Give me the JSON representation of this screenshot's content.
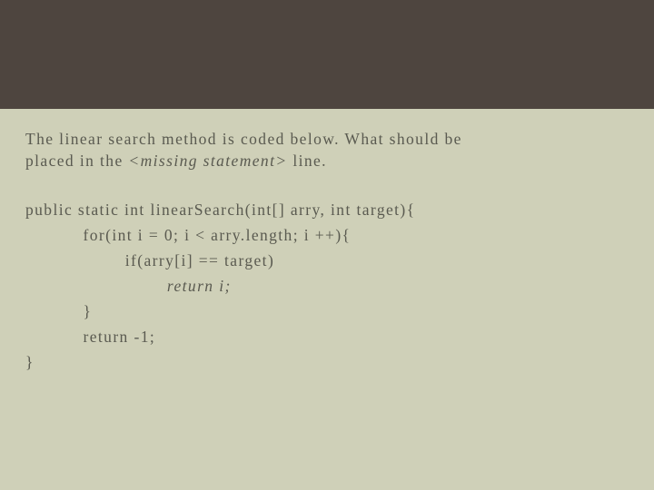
{
  "question": {
    "line1_pre": "The linear search method is coded below. What should be",
    "line2_pre": "placed in the ",
    "line2_italic": "<missing statement>",
    "line2_post": " line."
  },
  "code": {
    "l1": "public static int linearSearch(int[] arry, int target){",
    "l2": "           for(int i = 0; i < arry.length; i ++){",
    "l3": "                   if(arry[i] == target)",
    "l4_italic": "                           return i;",
    "l5": "           }",
    "l6": "           return -1;",
    "l7": "}"
  }
}
